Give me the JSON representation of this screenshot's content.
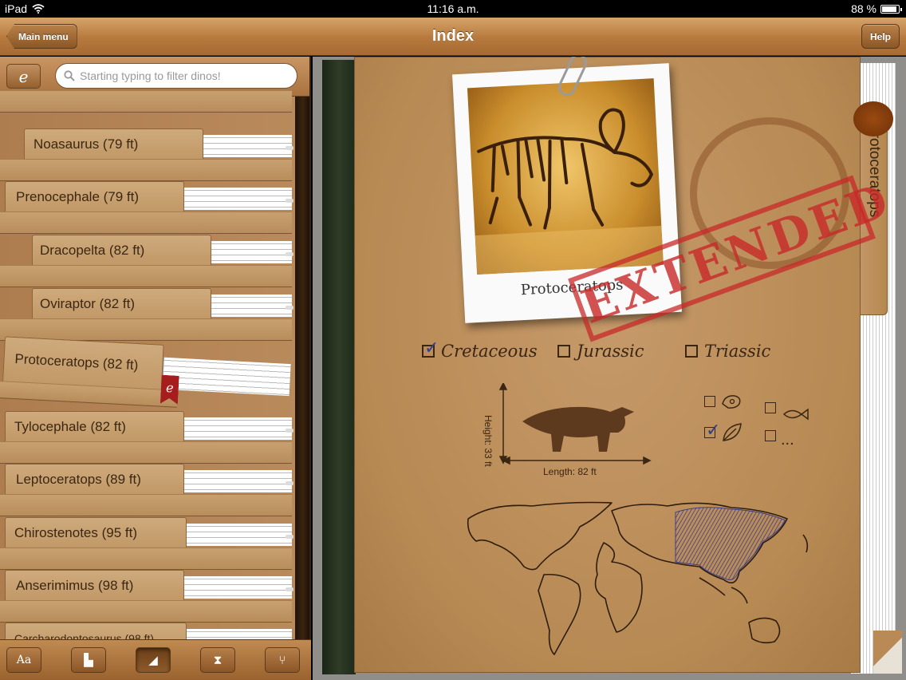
{
  "status_bar": {
    "device": "iPad",
    "time": "11:16 a.m.",
    "battery": "88 %",
    "battery_level": 0.88
  },
  "nav": {
    "back_label": "Main menu",
    "title": "Index",
    "help_label": "Help"
  },
  "search": {
    "placeholder": "Starting typing to filter dinos!"
  },
  "edit_icon_glyph": "e",
  "cards": [
    {
      "label": "Noasaurus (79 ft)"
    },
    {
      "label": "Prenocephale (79 ft)"
    },
    {
      "label": "Dracopelta (82 ft)"
    },
    {
      "label": "Oviraptor (82 ft)"
    },
    {
      "label": "Protoceratops (82 ft)",
      "selected": true
    },
    {
      "label": "Tylocephale (82 ft)"
    },
    {
      "label": "Leptoceratops (89 ft)"
    },
    {
      "label": "Chirostenotes (95 ft)"
    },
    {
      "label": "Anserimimus (98 ft)"
    },
    {
      "label": "Carcharodontosaurus (98 ft)"
    }
  ],
  "ribbon_glyph": "e",
  "toolbar": {
    "buttons": [
      {
        "name": "font-size-button",
        "glyph": "Aa"
      },
      {
        "name": "weight-button",
        "glyph": "▙"
      },
      {
        "name": "size-sort-button",
        "glyph": "◢",
        "active": true
      },
      {
        "name": "period-button",
        "glyph": "⧗"
      },
      {
        "name": "diet-button",
        "glyph": "⑂"
      }
    ]
  },
  "detail": {
    "folder_tab": "Protoceratops",
    "photo_caption": "Protoceratops",
    "stamp": "EXTENDED",
    "periods": [
      {
        "label": "Cretaceous",
        "checked": true
      },
      {
        "label": "Jurassic",
        "checked": false
      },
      {
        "label": "Triassic",
        "checked": false
      }
    ],
    "height_label": "Height: 33 ft",
    "length_label": "Length: 82 ft",
    "diet": [
      {
        "icon": "meat-icon",
        "checked": false
      },
      {
        "icon": "fish-icon",
        "checked": false
      },
      {
        "icon": "leaf-icon",
        "checked": true
      },
      {
        "icon": "ellipsis-icon",
        "label": "...",
        "checked": false
      }
    ]
  },
  "colors": {
    "accent_red": "#c82828",
    "check_blue": "#2f3f8e",
    "map_hatch": "#3b3d8c"
  }
}
